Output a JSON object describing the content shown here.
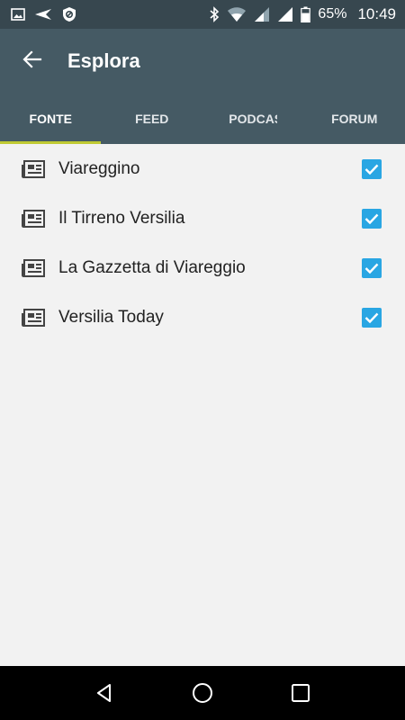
{
  "status_bar": {
    "battery_percent": "65%",
    "time": "10:49",
    "left_icons": [
      "image-icon",
      "send-icon",
      "vpn-shield-icon"
    ],
    "right_icons": [
      "bluetooth-icon",
      "wifi-icon",
      "signal-icon",
      "signal-icon",
      "battery-icon"
    ]
  },
  "app_bar": {
    "title": "Esplora",
    "back_icon": "arrow-back-icon"
  },
  "tabs": [
    {
      "label": "FONTE",
      "selected": true
    },
    {
      "label": "FEED",
      "selected": false
    },
    {
      "label": "PODCAST",
      "selected": false
    },
    {
      "label": "FORUM",
      "selected": false
    }
  ],
  "colors": {
    "status_bar": "#37474f",
    "app_bar": "#455a64",
    "tab_indicator": "#c0ca33",
    "checkbox": "#29a6e3",
    "background": "#f2f2f2"
  },
  "sources": [
    {
      "label": "Viareggino",
      "icon": "newspaper-icon",
      "checked": true
    },
    {
      "label": "Il Tirreno Versilia",
      "icon": "newspaper-icon",
      "checked": true
    },
    {
      "label": "La Gazzetta di Viareggio",
      "icon": "newspaper-icon",
      "checked": true
    },
    {
      "label": "Versilia Today",
      "icon": "newspaper-icon",
      "checked": true
    }
  ],
  "nav_bar": {
    "buttons": [
      "back-triangle-icon",
      "home-circle-icon",
      "recents-square-icon"
    ]
  }
}
